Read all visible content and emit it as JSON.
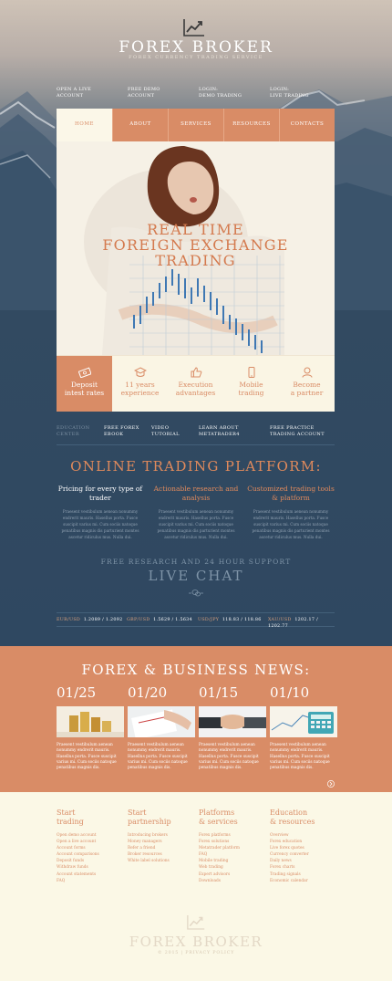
{
  "header": {
    "brand": "FOREX BROKER",
    "tagline": "FOREX CURRENCY TRADING SERVICE",
    "top_links": [
      {
        "line1": "OPEN A LIVE",
        "line2": "ACCOUNT"
      },
      {
        "line1": "FREE DEMO",
        "line2": "ACCOUNT"
      },
      {
        "line1": "LOGIN:",
        "line2": "DEMO TRADING"
      },
      {
        "line1": "LOGIN:",
        "line2": "LIVE TRADING"
      }
    ]
  },
  "nav": {
    "items": [
      "HOME",
      "ABOUT",
      "SERVICES",
      "RESOURCES",
      "CONTACTS"
    ]
  },
  "hero": {
    "headline": [
      "REAL TIME",
      "FOREIGN EXCHANGE",
      "TRADING"
    ]
  },
  "features": [
    {
      "icon": "money-icon",
      "line1": "Deposit",
      "line2": "intest rates"
    },
    {
      "icon": "graduation-cap-icon",
      "line1": "11 years",
      "line2": "experience"
    },
    {
      "icon": "thumbs-up-icon",
      "line1": "Execution",
      "line2": "advantages"
    },
    {
      "icon": "mobile-icon",
      "line1": "Mobile",
      "line2": "trading"
    },
    {
      "icon": "person-icon",
      "line1": "Become",
      "line2": "a partner"
    }
  ],
  "sublinks": [
    {
      "line1": "EDUCATION",
      "line2": "CENTER"
    },
    {
      "line1": "FREE FOREX",
      "line2": "EBOOK"
    },
    {
      "line1": "VIDEO",
      "line2": "TUTORIAL"
    },
    {
      "line1": "LEARN ABOUT",
      "line2": "METATRADER4"
    },
    {
      "line1": "FREE PRACTICE",
      "line2": "TRADING ACCOUNT"
    }
  ],
  "platform": {
    "title": "ONLINE TRADING PLATFORM:",
    "columns": [
      {
        "title": "Pricing for every type of trader",
        "text": "Praesent vestibulum aenean nonummy endrerit mauris. Hasellus porta. Fusce suscipit varius mi. Cum sociis natoque penatibus magnis dis parturient montes ascetur ridiculus mus. Nulla dui."
      },
      {
        "title": "Actionable research and analysis",
        "text": "Praesent vestibulum aenean nonummy endrerit mauris. Hasellus porta. Fusce suscipit varius mi. Cum sociis natoque penatibus magnis dis parturient montes ascetur ridiculus mus. Nulla dui."
      },
      {
        "title": "Customized trading tools & platform",
        "text": "Praesent vestibulum aenean nonummy endrerit mauris. Hasellus porta. Fusce suscipit varius mi. Cum sociis natoque penatibus magnis dis parturient montes ascetur ridiculus mus. Nulla dui."
      }
    ]
  },
  "support": {
    "line": "FREE RESEARCH AND 24 HOUR SUPPORT",
    "chat": "LIVE CHAT"
  },
  "rates": [
    {
      "pair": "EUR/USD",
      "value": "1.2089 / 1.2092"
    },
    {
      "pair": "GBP/USD",
      "value": "1.5629 / 1.5634"
    },
    {
      "pair": "USD/JPY",
      "value": "118.83 / 118.86"
    },
    {
      "pair": "XAU/USD",
      "value": "1202.17 / 1202.77"
    }
  ],
  "news": {
    "title": "FOREX & BUSINESS NEWS:",
    "items": [
      {
        "date": "01/25",
        "image": "coins-image",
        "text": "Praesent vestibulum aenean nonummy endrerit mauris. Hasellus porta. Fusce suscipit varius mi. Cum sociis natoque penatibus magnis dis."
      },
      {
        "date": "01/20",
        "image": "hand-document-image",
        "text": "Praesent vestibulum aenean nonummy endrerit mauris. Hasellus porta. Fusce suscipit varius mi. Cum sociis natoque penatibus magnis dis."
      },
      {
        "date": "01/15",
        "image": "handshake-image",
        "text": "Praesent vestibulum aenean nonummy endrerit mauris. Hasellus porta. Fusce suscipit varius mi. Cum sociis natoque penatibus magnis dis."
      },
      {
        "date": "01/10",
        "image": "calculator-image",
        "text": "Praesent vestibulum aenean nonummy endrerit mauris. Hasellus porta. Fusce suscipit varius mi. Cum sociis natoque penatibus magnis dis."
      }
    ]
  },
  "footer": {
    "columns": [
      {
        "title": [
          "Start",
          "trading"
        ],
        "links": [
          "Open demo account",
          "Open a live account",
          "Account forms",
          "Account comparisons",
          "Deposit funds",
          "Withdraw funds",
          "Account statements",
          "FAQ"
        ]
      },
      {
        "title": [
          "Start",
          "partnership"
        ],
        "links": [
          "Introducing brokers",
          "Money managers",
          "Refer a friend",
          "Broker resources",
          "White label solutions"
        ]
      },
      {
        "title": [
          "Platforms",
          "& services"
        ],
        "links": [
          "Forex platforms",
          "Forex solutions",
          "Metatrader platform",
          "FAQ",
          "Mobile trading",
          "Web trading",
          "Expert advisors",
          "Downloads"
        ]
      },
      {
        "title": [
          "Education",
          "& resources"
        ],
        "links": [
          "Overview",
          "Forex education",
          "Live forex quotes",
          "Currency converter",
          "Daily news",
          "Forex charts",
          "Trading signals",
          "Economic calendar"
        ]
      }
    ],
    "brand": "FOREX BROKER",
    "copyright": "© 2015 | PRIVACY POLICY"
  },
  "colors": {
    "accent": "#d98c66",
    "navy": "#2f4861",
    "cream": "#fbf8e6"
  }
}
